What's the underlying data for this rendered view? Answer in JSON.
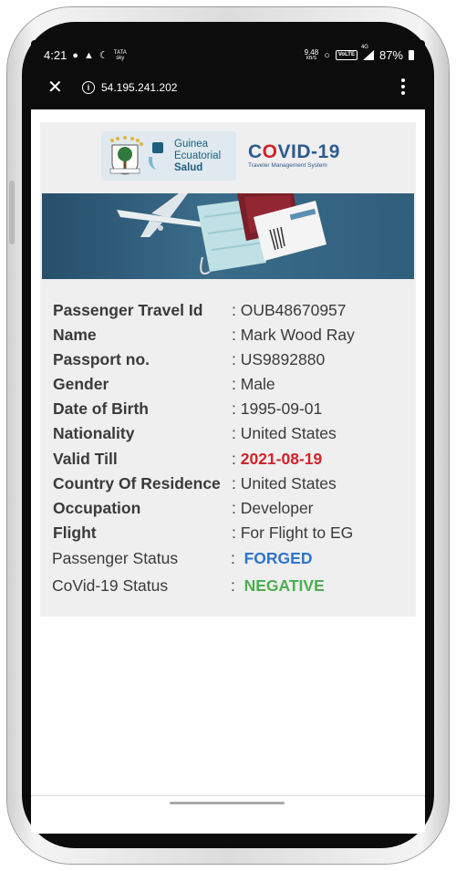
{
  "status_bar": {
    "time": "4:21",
    "carrier_top": "TATA",
    "carrier_bottom": "sky",
    "speed_value": "9.48",
    "speed_unit": "KB/S",
    "volte": "VoLTE",
    "network": "4G",
    "battery": "87%"
  },
  "browser": {
    "url": "54.195.241.202",
    "close_icon": "close-icon",
    "info_icon": "info-icon",
    "menu_icon": "more-vert-icon"
  },
  "header": {
    "brand_line1": "Guinea",
    "brand_line2": "Ecuatorial",
    "brand_line3": "Salud",
    "covid_title_left": "C",
    "covid_title_o": "O",
    "covid_title_right": "VID-19",
    "covid_subtitle": "Traveler Management System"
  },
  "details": [
    {
      "label": "Passenger Travel Id",
      "value": "OUB48670957"
    },
    {
      "label": "Name",
      "value": "Mark Wood Ray"
    },
    {
      "label": "Passport no.",
      "value": "US9892880"
    },
    {
      "label": "Gender",
      "value": "Male"
    },
    {
      "label": "Date of Birth",
      "value": "1995-09-01"
    },
    {
      "label": "Nationality",
      "value": "United States"
    },
    {
      "label": "Valid Till",
      "value": "2021-08-19"
    },
    {
      "label": "Country Of Residence",
      "value": "United States"
    },
    {
      "label": "Occupation",
      "value": "Developer"
    },
    {
      "label": "Flight",
      "value": "For Flight to EG"
    }
  ],
  "status": [
    {
      "label": "Passenger Status",
      "value": "FORGED"
    },
    {
      "label": "CoVid-19 Status",
      "value": "NEGATIVE"
    }
  ],
  "colors": {
    "valid_till": "#d2232a",
    "forged": "#2f74c9",
    "negative": "#4caf50",
    "brand_blue": "#2c5a90"
  }
}
